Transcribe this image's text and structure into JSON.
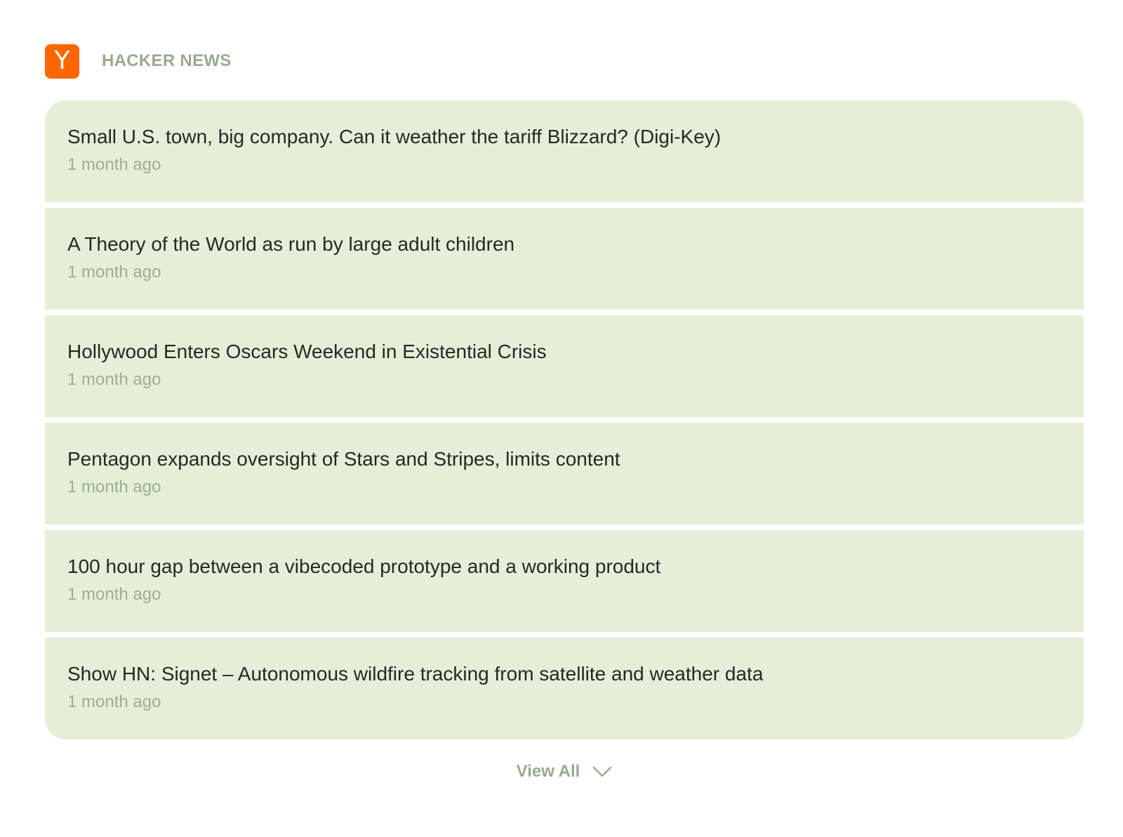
{
  "source": {
    "logo_letter": "Y",
    "name": "HACKER NEWS",
    "logo_color": "#ff6600"
  },
  "items": [
    {
      "title": "Small U.S. town, big company. Can it weather the tariff Blizzard? (Digi-Key)",
      "time": "1 month ago"
    },
    {
      "title": "A Theory of the World as run by large adult children",
      "time": "1 month ago"
    },
    {
      "title": "Hollywood Enters Oscars Weekend in Existential Crisis",
      "time": "1 month ago"
    },
    {
      "title": "Pentagon expands oversight of Stars and Stripes, limits content",
      "time": "1 month ago"
    },
    {
      "title": "100 hour gap between a vibecoded prototype and a working product",
      "time": "1 month ago"
    },
    {
      "title": "Show HN: Signet – Autonomous wildfire tracking from satellite and weather data",
      "time": "1 month ago"
    }
  ],
  "footer": {
    "view_all_label": "View All",
    "icon": "chevron-down-icon"
  },
  "colors": {
    "card_background": "#e4eed9",
    "muted_text": "#9aaa8e",
    "title_text": "#232a21"
  }
}
